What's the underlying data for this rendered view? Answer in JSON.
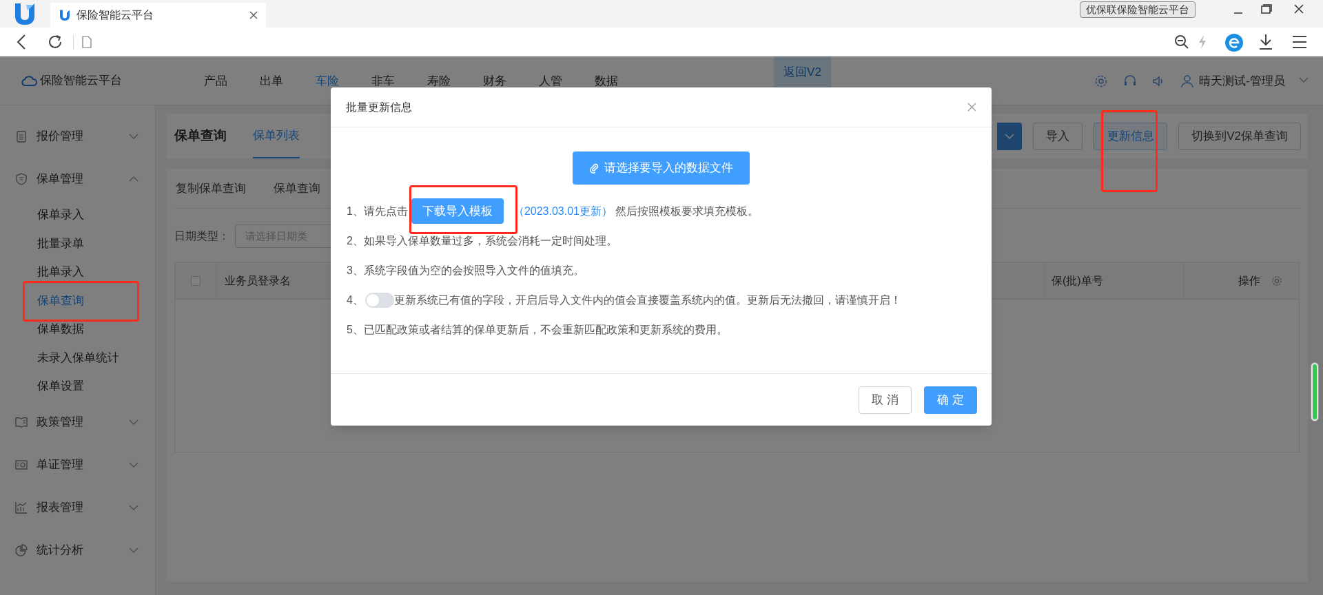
{
  "browser": {
    "tab_title": "保险智能云平台",
    "title_badge": "优保联保险智能云平台"
  },
  "app": {
    "brand": "保险智能云平台",
    "nav": [
      {
        "label": "产品",
        "selected": false
      },
      {
        "label": "出单",
        "selected": false
      },
      {
        "label": "车险",
        "selected": true
      },
      {
        "label": "非车",
        "selected": false
      },
      {
        "label": "寿险",
        "selected": false
      },
      {
        "label": "财务",
        "selected": false
      },
      {
        "label": "人管",
        "selected": false
      },
      {
        "label": "数据",
        "selected": false
      }
    ],
    "return_button": "返回V2",
    "user": "晴天测试-管理员"
  },
  "sidebar": [
    {
      "label": "报价管理",
      "kind": "quote",
      "expanded": false
    },
    {
      "label": "保单管理",
      "kind": "policy",
      "expanded": true,
      "children": [
        {
          "label": "保单录入",
          "selected": false,
          "highlighted": false
        },
        {
          "label": "批量录单",
          "selected": false,
          "highlighted": false
        },
        {
          "label": "批单录入",
          "selected": false,
          "highlighted": false
        },
        {
          "label": "保单查询",
          "selected": true,
          "highlighted": true
        },
        {
          "label": "保单数据",
          "selected": false,
          "highlighted": false
        },
        {
          "label": "未录入保单统计",
          "selected": false,
          "highlighted": false
        },
        {
          "label": "保单设置",
          "selected": false,
          "highlighted": false
        }
      ]
    },
    {
      "label": "政策管理",
      "kind": "rules",
      "expanded": false
    },
    {
      "label": "单证管理",
      "kind": "certificate",
      "expanded": false
    },
    {
      "label": "报表管理",
      "kind": "report",
      "expanded": false
    },
    {
      "label": "统计分析",
      "kind": "stats",
      "expanded": false
    }
  ],
  "page": {
    "title": "保单查询",
    "tabs": [
      {
        "label": "保单列表",
        "selected": true
      }
    ],
    "actions": [
      {
        "kind": "dropdown",
        "highlighted": false
      },
      {
        "label": "导入",
        "kind": "plain",
        "highlighted": false
      },
      {
        "label": "更新信息",
        "kind": "active",
        "highlighted": true
      },
      {
        "label": "切换到V2保单查询",
        "kind": "plain",
        "highlighted": false
      }
    ],
    "subtabs": [
      "复制保单查询",
      "保单查询"
    ],
    "filter": {
      "label": "日期类型：",
      "placeholder": "请选择日期类"
    },
    "table": {
      "header_checkbox": {
        "checked": false
      },
      "columns": [
        "业务员登录名",
        "保(批)单号",
        "操作"
      ]
    }
  },
  "dialog": {
    "title": "批量更新信息",
    "upload_button": "请选择要导入的数据文件",
    "steps": [
      {
        "kind": "download",
        "prefix": "1、请先点击",
        "button": "下载导入模板",
        "highlighted": true,
        "link": "（2023.03.01更新）",
        "suffix": "然后按照模板要求填充模板。"
      },
      {
        "kind": "text",
        "text": "2、如果导入保单数量过多，系统会消耗一定时间处理。"
      },
      {
        "kind": "text",
        "text": "3、系统字段值为空的会按照导入文件的值填充。"
      },
      {
        "kind": "toggle",
        "prefix": "4、",
        "on": false,
        "text": "更新系统已有值的字段，开启后导入文件内的值会直接覆盖系统内的值。更新后无法撤回，请谨慎开启！"
      },
      {
        "kind": "text",
        "text": "5、已匹配政策或者结算的保单更新后，不会重新匹配政策和更新系统的费用。"
      }
    ],
    "buttons": [
      {
        "label": "取 消",
        "kind": "secondary"
      },
      {
        "label": "确 定",
        "kind": "primary"
      }
    ]
  }
}
